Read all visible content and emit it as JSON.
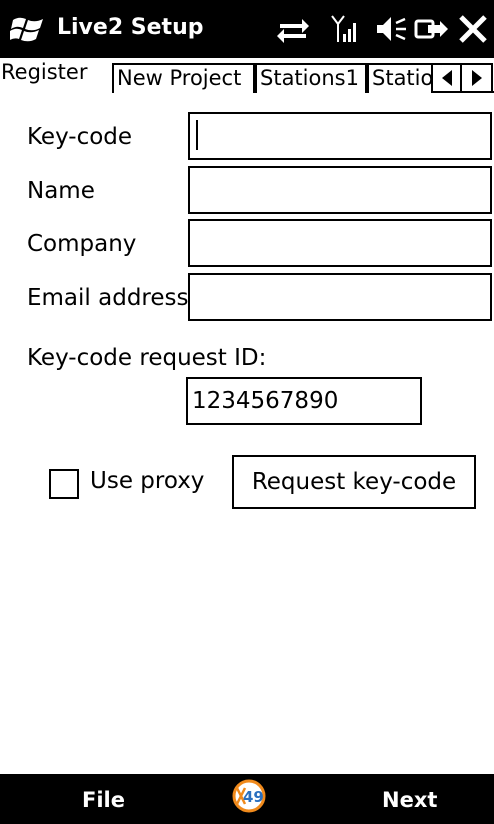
{
  "titlebar": {
    "title": "Live2 Setup",
    "icons": [
      "windows-flag-icon",
      "sync-icon",
      "signal-icon",
      "volume-icon",
      "power-icon",
      "close-icon"
    ]
  },
  "tabs": [
    {
      "label": "Register",
      "active": true
    },
    {
      "label": "New Project",
      "active": false
    },
    {
      "label": "Stations1",
      "active": false
    },
    {
      "label": "Statio",
      "active": false
    }
  ],
  "form": {
    "keycode_label": "Key-code",
    "keycode_value": "",
    "name_label": "Name",
    "name_value": "",
    "company_label": "Company",
    "company_value": "",
    "email_label": "Email address",
    "email_value": "",
    "request_id_label": "Key-code request ID:",
    "request_id_value": "1234567890",
    "use_proxy_label": "Use proxy",
    "use_proxy_checked": false,
    "request_button_label": "Request key-code"
  },
  "menubar": {
    "left_label": "File",
    "right_label": "Next",
    "logo_text": "49"
  },
  "colors": {
    "bar_background": "#000000",
    "bar_text": "#ffffff",
    "logo_orange": "#f08a1c",
    "logo_blue": "#2a6fbf"
  }
}
